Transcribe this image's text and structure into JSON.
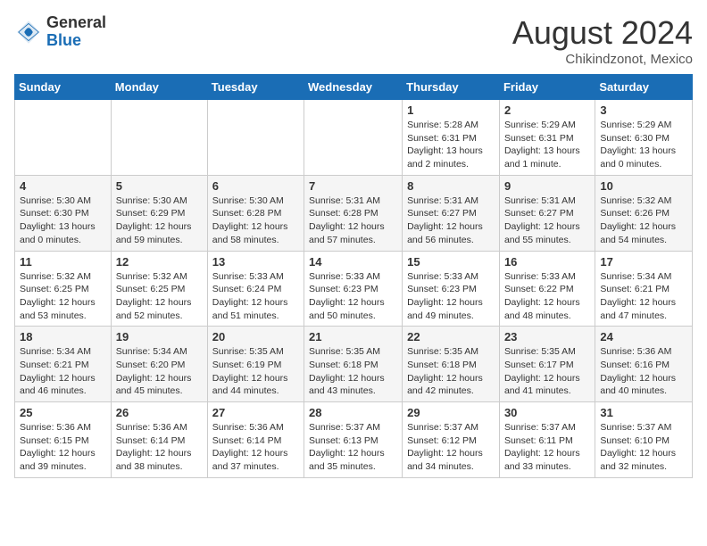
{
  "header": {
    "logo_general": "General",
    "logo_blue": "Blue",
    "month_year": "August 2024",
    "location": "Chikindzonot, Mexico"
  },
  "days_of_week": [
    "Sunday",
    "Monday",
    "Tuesday",
    "Wednesday",
    "Thursday",
    "Friday",
    "Saturday"
  ],
  "weeks": [
    [
      {
        "day": "",
        "info": ""
      },
      {
        "day": "",
        "info": ""
      },
      {
        "day": "",
        "info": ""
      },
      {
        "day": "",
        "info": ""
      },
      {
        "day": "1",
        "info": "Sunrise: 5:28 AM\nSunset: 6:31 PM\nDaylight: 13 hours\nand 2 minutes."
      },
      {
        "day": "2",
        "info": "Sunrise: 5:29 AM\nSunset: 6:31 PM\nDaylight: 13 hours\nand 1 minute."
      },
      {
        "day": "3",
        "info": "Sunrise: 5:29 AM\nSunset: 6:30 PM\nDaylight: 13 hours\nand 0 minutes."
      }
    ],
    [
      {
        "day": "4",
        "info": "Sunrise: 5:30 AM\nSunset: 6:30 PM\nDaylight: 13 hours\nand 0 minutes."
      },
      {
        "day": "5",
        "info": "Sunrise: 5:30 AM\nSunset: 6:29 PM\nDaylight: 12 hours\nand 59 minutes."
      },
      {
        "day": "6",
        "info": "Sunrise: 5:30 AM\nSunset: 6:28 PM\nDaylight: 12 hours\nand 58 minutes."
      },
      {
        "day": "7",
        "info": "Sunrise: 5:31 AM\nSunset: 6:28 PM\nDaylight: 12 hours\nand 57 minutes."
      },
      {
        "day": "8",
        "info": "Sunrise: 5:31 AM\nSunset: 6:27 PM\nDaylight: 12 hours\nand 56 minutes."
      },
      {
        "day": "9",
        "info": "Sunrise: 5:31 AM\nSunset: 6:27 PM\nDaylight: 12 hours\nand 55 minutes."
      },
      {
        "day": "10",
        "info": "Sunrise: 5:32 AM\nSunset: 6:26 PM\nDaylight: 12 hours\nand 54 minutes."
      }
    ],
    [
      {
        "day": "11",
        "info": "Sunrise: 5:32 AM\nSunset: 6:25 PM\nDaylight: 12 hours\nand 53 minutes."
      },
      {
        "day": "12",
        "info": "Sunrise: 5:32 AM\nSunset: 6:25 PM\nDaylight: 12 hours\nand 52 minutes."
      },
      {
        "day": "13",
        "info": "Sunrise: 5:33 AM\nSunset: 6:24 PM\nDaylight: 12 hours\nand 51 minutes."
      },
      {
        "day": "14",
        "info": "Sunrise: 5:33 AM\nSunset: 6:23 PM\nDaylight: 12 hours\nand 50 minutes."
      },
      {
        "day": "15",
        "info": "Sunrise: 5:33 AM\nSunset: 6:23 PM\nDaylight: 12 hours\nand 49 minutes."
      },
      {
        "day": "16",
        "info": "Sunrise: 5:33 AM\nSunset: 6:22 PM\nDaylight: 12 hours\nand 48 minutes."
      },
      {
        "day": "17",
        "info": "Sunrise: 5:34 AM\nSunset: 6:21 PM\nDaylight: 12 hours\nand 47 minutes."
      }
    ],
    [
      {
        "day": "18",
        "info": "Sunrise: 5:34 AM\nSunset: 6:21 PM\nDaylight: 12 hours\nand 46 minutes."
      },
      {
        "day": "19",
        "info": "Sunrise: 5:34 AM\nSunset: 6:20 PM\nDaylight: 12 hours\nand 45 minutes."
      },
      {
        "day": "20",
        "info": "Sunrise: 5:35 AM\nSunset: 6:19 PM\nDaylight: 12 hours\nand 44 minutes."
      },
      {
        "day": "21",
        "info": "Sunrise: 5:35 AM\nSunset: 6:18 PM\nDaylight: 12 hours\nand 43 minutes."
      },
      {
        "day": "22",
        "info": "Sunrise: 5:35 AM\nSunset: 6:18 PM\nDaylight: 12 hours\nand 42 minutes."
      },
      {
        "day": "23",
        "info": "Sunrise: 5:35 AM\nSunset: 6:17 PM\nDaylight: 12 hours\nand 41 minutes."
      },
      {
        "day": "24",
        "info": "Sunrise: 5:36 AM\nSunset: 6:16 PM\nDaylight: 12 hours\nand 40 minutes."
      }
    ],
    [
      {
        "day": "25",
        "info": "Sunrise: 5:36 AM\nSunset: 6:15 PM\nDaylight: 12 hours\nand 39 minutes."
      },
      {
        "day": "26",
        "info": "Sunrise: 5:36 AM\nSunset: 6:14 PM\nDaylight: 12 hours\nand 38 minutes."
      },
      {
        "day": "27",
        "info": "Sunrise: 5:36 AM\nSunset: 6:14 PM\nDaylight: 12 hours\nand 37 minutes."
      },
      {
        "day": "28",
        "info": "Sunrise: 5:37 AM\nSunset: 6:13 PM\nDaylight: 12 hours\nand 35 minutes."
      },
      {
        "day": "29",
        "info": "Sunrise: 5:37 AM\nSunset: 6:12 PM\nDaylight: 12 hours\nand 34 minutes."
      },
      {
        "day": "30",
        "info": "Sunrise: 5:37 AM\nSunset: 6:11 PM\nDaylight: 12 hours\nand 33 minutes."
      },
      {
        "day": "31",
        "info": "Sunrise: 5:37 AM\nSunset: 6:10 PM\nDaylight: 12 hours\nand 32 minutes."
      }
    ]
  ]
}
